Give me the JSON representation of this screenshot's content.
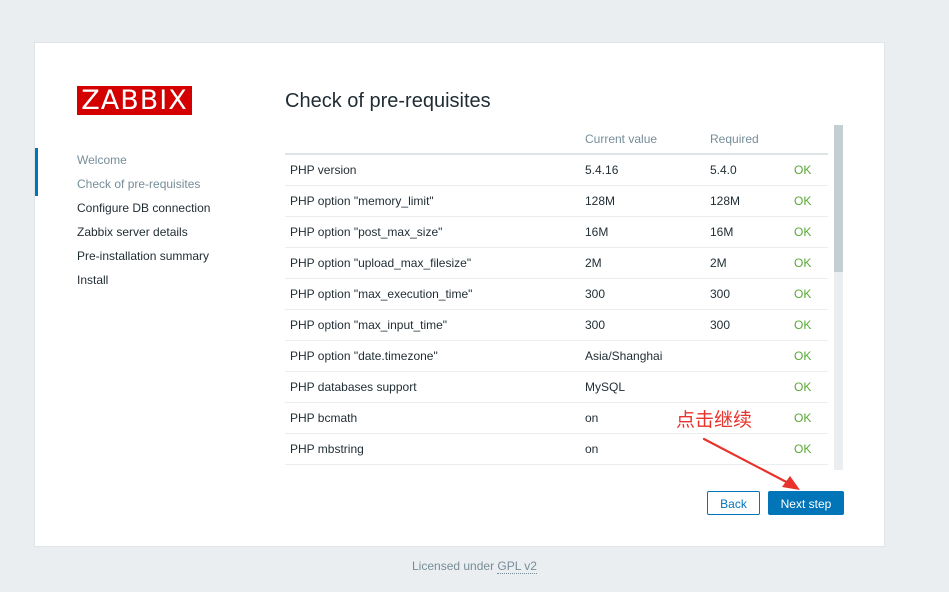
{
  "logo": {
    "text": "ZABBIX"
  },
  "sidebar": {
    "steps": [
      {
        "label": "Welcome"
      },
      {
        "label": "Check of pre-requisites"
      },
      {
        "label": "Configure DB connection"
      },
      {
        "label": "Zabbix server details"
      },
      {
        "label": "Pre-installation summary"
      },
      {
        "label": "Install"
      }
    ]
  },
  "main": {
    "title": "Check of pre-requisites",
    "columns": [
      "",
      "Current value",
      "Required",
      ""
    ],
    "rows": [
      {
        "name": "PHP version",
        "current": "5.4.16",
        "required": "5.4.0",
        "status": "OK"
      },
      {
        "name": "PHP option \"memory_limit\"",
        "current": "128M",
        "required": "128M",
        "status": "OK"
      },
      {
        "name": "PHP option \"post_max_size\"",
        "current": "16M",
        "required": "16M",
        "status": "OK"
      },
      {
        "name": "PHP option \"upload_max_filesize\"",
        "current": "2M",
        "required": "2M",
        "status": "OK"
      },
      {
        "name": "PHP option \"max_execution_time\"",
        "current": "300",
        "required": "300",
        "status": "OK"
      },
      {
        "name": "PHP option \"max_input_time\"",
        "current": "300",
        "required": "300",
        "status": "OK"
      },
      {
        "name": "PHP option \"date.timezone\"",
        "current": "Asia/Shanghai",
        "required": "",
        "status": "OK"
      },
      {
        "name": "PHP databases support",
        "current": "MySQL",
        "required": "",
        "status": "OK"
      },
      {
        "name": "PHP bcmath",
        "current": "on",
        "required": "",
        "status": "OK"
      },
      {
        "name": "PHP mbstring",
        "current": "on",
        "required": "",
        "status": "OK"
      }
    ]
  },
  "buttons": {
    "back": "Back",
    "next": "Next step"
  },
  "annotation": {
    "text": "点击继续"
  },
  "footer": {
    "prefix": "Licensed under",
    "link": "GPL v2"
  },
  "colors": {
    "accent": "#0275b8",
    "ok": "#59a935",
    "logo": "#d40000",
    "annotation": "#e8332c"
  }
}
